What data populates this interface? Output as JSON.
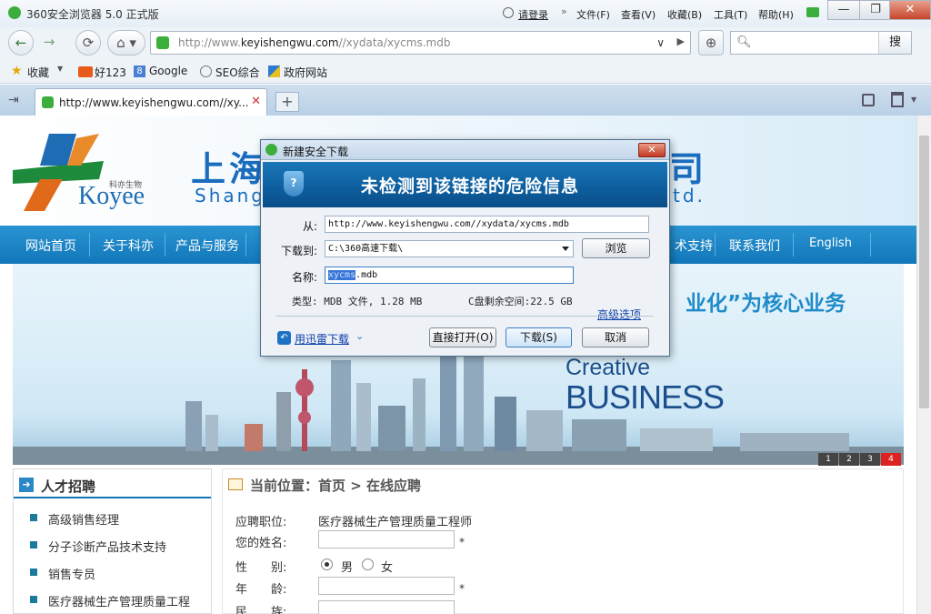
{
  "window": {
    "title": "360安全浏览器 5.0 正式版",
    "login": "请登录",
    "menus": [
      "文件(F)",
      "查看(V)",
      "收藏(B)",
      "工具(T)",
      "帮助(H)"
    ],
    "minimize": "—",
    "restore": "❐",
    "close": "✕"
  },
  "toolbar": {
    "url_prefix": "http://www.",
    "url_host": "keyishengwu.com",
    "url_path": "//xydata/xycms.mdb",
    "search_placeholder": "",
    "search_button": "搜"
  },
  "favorites": {
    "label": "收藏",
    "items": [
      "好123",
      "Google",
      "SEO综合",
      "政府网站"
    ]
  },
  "tabs": [
    {
      "title": "http://www.keyishengwu.com//xy..."
    }
  ],
  "site": {
    "brand": "Koyee",
    "brand_cn": "科亦生物",
    "company_cn": "上海",
    "company_cn_tail": "司",
    "company_en": "Shang",
    "company_en_tail": "td.",
    "nav": [
      "网站首页",
      "关于科亦",
      "产品与服务",
      "术支持",
      "联系我们",
      "English"
    ],
    "slogan": "业化”为核心业务",
    "banner_en_1": "Creative",
    "banner_en_2": "BUSINESS",
    "pager": [
      "1",
      "2",
      "3",
      "4"
    ],
    "sidebar_title": "人才招聘",
    "jobs": [
      "高级销售经理",
      "分子诊断产品技术支持",
      "销售专员",
      "医疗器械生产管理质量工程"
    ],
    "breadcrumb": "当前位置：首页 > 在线应聘",
    "form": {
      "position_label": "应聘职位:",
      "position_value": "医疗器械生产管理质量工程师",
      "name_label": "您的姓名:",
      "gender_label": "性　　别:",
      "gender_male": "男",
      "gender_female": "女",
      "age_label": "年　　龄:",
      "ethnic_label": "民　　族:",
      "required_mark": "*"
    }
  },
  "dialog": {
    "title": "新建安全下载",
    "banner": "未检测到该链接的危险信息",
    "from_label": "从:",
    "from_value": "http://www.keyishengwu.com//xydata/xycms.mdb",
    "saveto_label": "下载到:",
    "saveto_value": "C:\\360高速下载\\",
    "browse_button": "浏览",
    "name_label": "名称:",
    "name_selected": "xycms",
    "name_ext": ".mdb",
    "type_info": "类型: MDB 文件, 1.28 MB",
    "space_info": "C盘剩余空间:22.5 GB",
    "advanced_link": "高级选项",
    "thunder_link": "用迅雷下载",
    "open_button": "直接打开(O)",
    "download_button": "下载(S)",
    "cancel_button": "取消"
  }
}
